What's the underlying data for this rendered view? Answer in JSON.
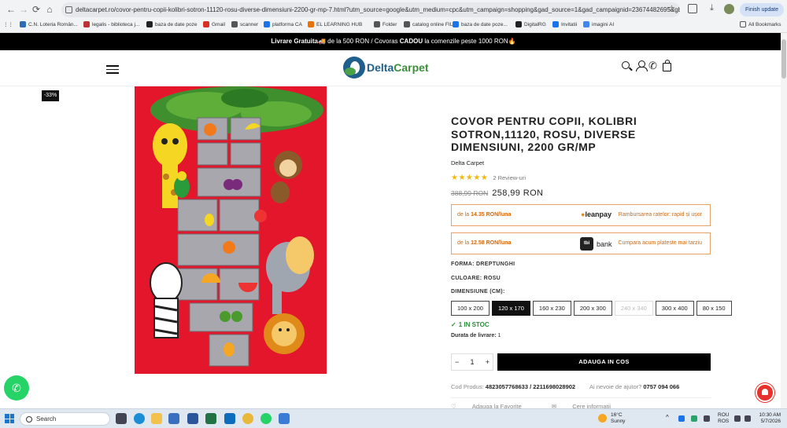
{
  "browser": {
    "url": "deltacarpet.ro/covor-pentru-copii-kolibri-sotron-11120-rosu-diverse-dimensiuni-2200-gr-mp-7.html?utm_source=google&utm_medium=cpc&utm_campaign=shopping&gad_source=1&gad_campaignid=23674482695&gbraid=0...",
    "finish_update": "Finish update",
    "bookmarks": [
      {
        "label": "C.N. Loteria Român...",
        "color": "#2a6db5"
      },
      {
        "label": "legalis - biblioteca j...",
        "color": "#b33"
      },
      {
        "label": "baza de date poze",
        "color": "#222"
      },
      {
        "label": "Gmail",
        "color": "#d93025"
      },
      {
        "label": "scanner",
        "color": "#555"
      },
      {
        "label": "platforma CA",
        "color": "#1a73e8"
      },
      {
        "label": "EL LEARNING HUB",
        "color": "#e8710a"
      },
      {
        "label": "Folder",
        "color": "#555"
      },
      {
        "label": "catalog online FILIP",
        "color": "#555"
      },
      {
        "label": "baza de date poze...",
        "color": "#1a73e8"
      },
      {
        "label": "DigitalRG",
        "color": "#222"
      },
      {
        "label": "Invitatii",
        "color": "#1a73e8"
      },
      {
        "label": "imagini AI",
        "color": "#4285f4"
      }
    ],
    "all_bookmarks": "All Bookmarks"
  },
  "promo": {
    "bold1": "Livrare Gratuita",
    "emoji1": "🚚",
    "text1": " de la 500 RON / Covoras ",
    "bold2": "CADOU",
    "text2": " la comenzile peste 1000 RON",
    "emoji2": "🔥"
  },
  "header": {
    "logo_part1": "Delta",
    "logo_part2": "Carpet"
  },
  "product": {
    "discount_badge": "-33%",
    "title": "COVOR PENTRU COPII, KOLIBRI SOTRON,11120, ROSU, DIVERSE DIMENSIUNI, 2200 GR/MP",
    "brand": "Delta Carpet",
    "stars": "★★★★★",
    "reviews": "2 Review-uri",
    "old_price": "388,99 RON",
    "new_price": "258,99 RON",
    "leanpay": {
      "prefix": "de la ",
      "amount": "14.35 RON/luna",
      "logo": "leanpay",
      "tagline": "Rambursarea ratelor: rapid și ușor"
    },
    "tbi": {
      "prefix": "de la ",
      "amount": "12.58 RON/luna",
      "logo_mark": "tbi",
      "logo_text": "bank",
      "tagline": "Cumpara acum plateste mai tarziu"
    },
    "forma_label": "FORMA:",
    "forma_value": "DREPTUNGHI",
    "culoare_label": "CULOARE:",
    "culoare_value": "ROSU",
    "dimensiune_label": "DIMENSIUNE (CM):",
    "sizes": [
      {
        "label": "100 x 200",
        "state": "normal"
      },
      {
        "label": "120 x 170",
        "state": "selected"
      },
      {
        "label": "160 x 230",
        "state": "normal"
      },
      {
        "label": "200 x 300",
        "state": "normal"
      },
      {
        "label": "240 x 340",
        "state": "disabled"
      },
      {
        "label": "300 x 400",
        "state": "normal"
      },
      {
        "label": "80 x 150",
        "state": "normal"
      }
    ],
    "stock": "1 IN STOC",
    "delivery_label": "Durata de livrare:",
    "delivery_value": "1",
    "quantity": "1",
    "add_to_cart": "ADAUGA IN COS",
    "code_label": "Cod Produs:",
    "code_value": "4823057768633 / 2211698028902",
    "help_label": "Ai nevoie de ajutor?",
    "help_phone": "0757 094 066",
    "wishlist": "Adauga la Favorite",
    "more_info": "Cere informatii"
  },
  "taskbar": {
    "search_placeholder": "Search",
    "weather_temp": "16°C",
    "weather_cond": "Sunny",
    "lang1": "ROU",
    "lang2": "ROS",
    "time": "10:30 AM",
    "date": "5/7/2026"
  },
  "colors": {
    "accent": "#000000",
    "stock_green": "#2e8b3d",
    "payment_orange": "#d2690e",
    "rug_red": "#e3162b"
  }
}
